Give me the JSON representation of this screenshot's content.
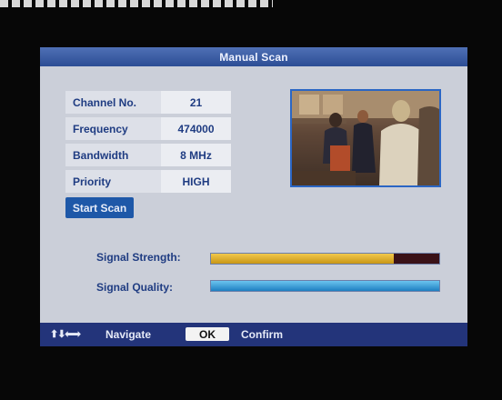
{
  "title": "Manual Scan",
  "fields": [
    {
      "label": "Channel No.",
      "value": "21"
    },
    {
      "label": "Frequency",
      "value": "474000"
    },
    {
      "label": "Bandwidth",
      "value": "8 MHz"
    },
    {
      "label": "Priority",
      "value": "HIGH"
    }
  ],
  "start_button": "Start Scan",
  "signal": {
    "strength_label": "Signal Strength:",
    "strength_level": 0.8,
    "quality_label": "Signal Quality:",
    "quality_level": 1.0
  },
  "footer": {
    "arrows": "⬆⬇⬅➡",
    "navigate": "Navigate",
    "ok": "OK",
    "confirm": "Confirm"
  },
  "colors": {
    "panel": "#cbcfd9",
    "title_bar": "#2c4d95",
    "text": "#1f3c82",
    "strength_fill": "#f2c94c",
    "quality_fill": "#1d7fc1"
  }
}
